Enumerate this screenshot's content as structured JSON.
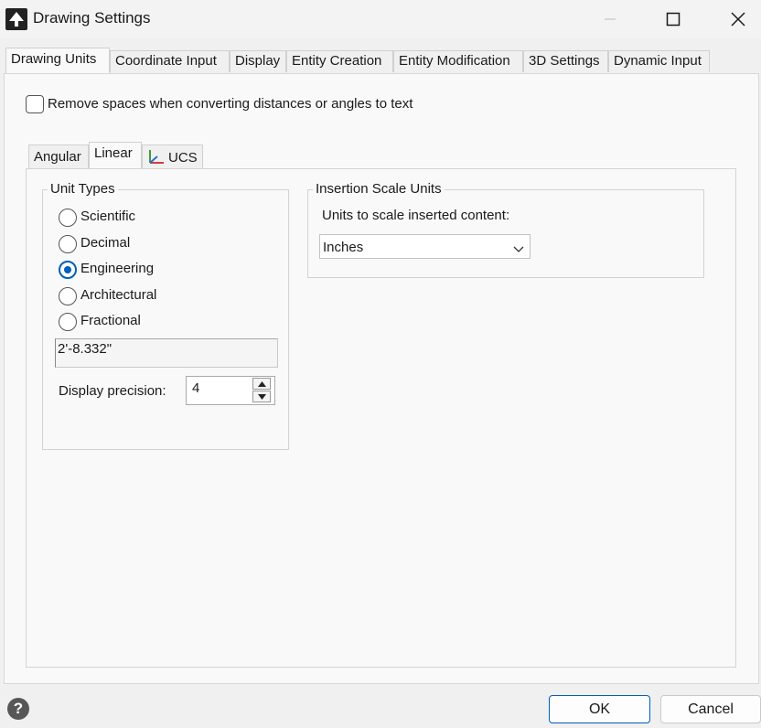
{
  "window": {
    "title": "Drawing Settings",
    "icons": [
      "app-logo-icon",
      "minimize-icon",
      "maximize-icon",
      "close-icon"
    ]
  },
  "tabs": [
    {
      "label": "Drawing Units",
      "active": true
    },
    {
      "label": "Coordinate Input",
      "active": false
    },
    {
      "label": "Display",
      "active": false
    },
    {
      "label": "Entity Creation",
      "active": false
    },
    {
      "label": "Entity Modification",
      "active": false
    },
    {
      "label": "3D Settings",
      "active": false
    },
    {
      "label": "Dynamic Input",
      "active": false
    }
  ],
  "remove_spaces": {
    "label": "Remove spaces when converting distances or angles to text",
    "checked": false
  },
  "subtabs": [
    {
      "label": "Angular",
      "active": false
    },
    {
      "label": "Linear",
      "active": true
    },
    {
      "label": "UCS",
      "active": false,
      "icon": "ucs-axes-icon"
    }
  ],
  "unit_types": {
    "legend": "Unit Types",
    "options": [
      {
        "label": "Scientific",
        "selected": false
      },
      {
        "label": "Decimal",
        "selected": false
      },
      {
        "label": "Engineering",
        "selected": true
      },
      {
        "label": "Architectural",
        "selected": false
      },
      {
        "label": "Fractional",
        "selected": false
      }
    ],
    "preview": "2'-8.332\"",
    "precision_label": "Display precision:",
    "precision_value": "4"
  },
  "insertion_scale": {
    "legend": "Insertion Scale Units",
    "label": "Units to scale inserted content:",
    "selected": "Inches"
  },
  "footer": {
    "ok": "OK",
    "cancel": "Cancel",
    "help_icon": "help-icon"
  },
  "colors": {
    "accent": "#005fb8",
    "window_bg": "#f0f0f0",
    "page_bg": "#f9f9f9"
  }
}
